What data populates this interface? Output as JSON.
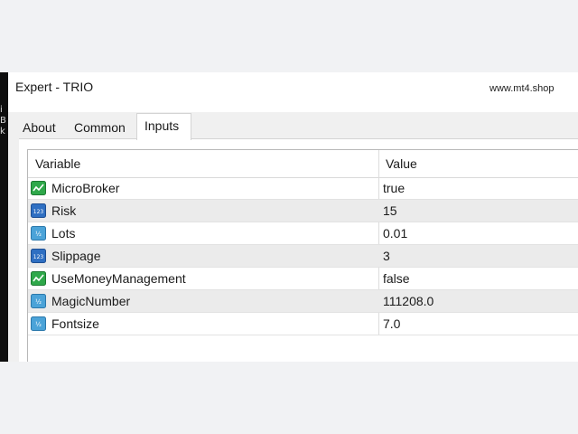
{
  "window": {
    "title": "Expert - TRIO",
    "site_label": "www.mt4.shop"
  },
  "tabs": [
    {
      "label": "About",
      "active": false
    },
    {
      "label": "Common",
      "active": false
    },
    {
      "label": "Inputs",
      "active": true
    }
  ],
  "grid": {
    "columns": [
      "Variable",
      "Value"
    ],
    "rows": [
      {
        "icon": "bool-icon",
        "variable": "MicroBroker",
        "value": "true"
      },
      {
        "icon": "int-icon",
        "variable": "Risk",
        "value": "15"
      },
      {
        "icon": "double-icon",
        "variable": "Lots",
        "value": "0.01"
      },
      {
        "icon": "int-icon",
        "variable": "Slippage",
        "value": "3"
      },
      {
        "icon": "bool-icon",
        "variable": "UseMoneyManagement",
        "value": "false"
      },
      {
        "icon": "double-icon",
        "variable": "MagicNumber",
        "value": "111208.0"
      },
      {
        "icon": "double-icon",
        "variable": "Fontsize",
        "value": "7.0"
      }
    ]
  },
  "colors": {
    "bool_icon": "#2fa84a",
    "int_icon": "#2f6fc2",
    "double_icon": "#4ba3d8",
    "alt_row": "#ebebeb",
    "backdrop": "#f1f2f4"
  }
}
